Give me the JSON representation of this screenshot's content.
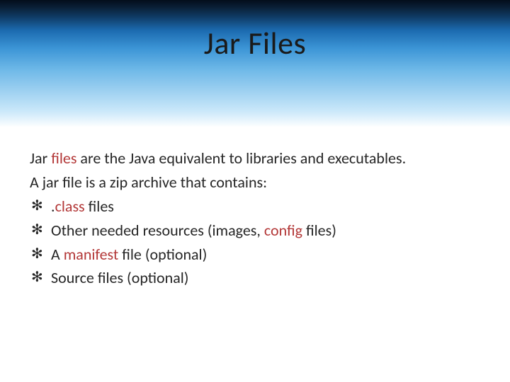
{
  "slide": {
    "title": "Jar Files",
    "line1_pre": "Jar ",
    "line1_accent": "files",
    "line1_post": " are the Java equivalent to libraries and executables.",
    "line2": "A jar file is a zip archive that contains:",
    "bullets": [
      {
        "pre": ".",
        "accent": "class",
        "post": " files"
      },
      {
        "pre": "Other needed resources (images, ",
        "accent": "config",
        "post": " files)"
      },
      {
        "pre": "A ",
        "accent": "manifest",
        "post": " file (optional)"
      },
      {
        "pre": "Source files (optional)",
        "accent": "",
        "post": ""
      }
    ],
    "bullet_glyph": "✻"
  }
}
